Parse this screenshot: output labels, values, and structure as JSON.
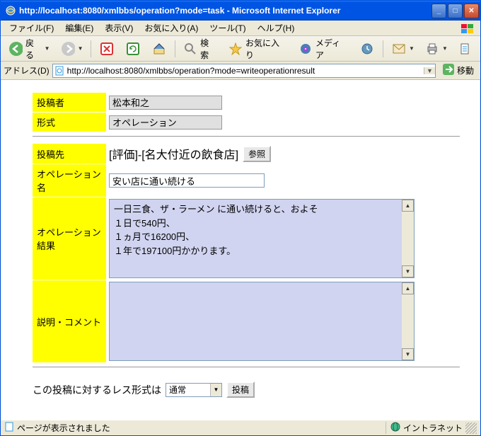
{
  "window_title": "http://localhost:8080/xmlbbs/operation?mode=task - Microsoft Internet Explorer",
  "menu": {
    "file": "ファイル(F)",
    "edit": "編集(E)",
    "view": "表示(V)",
    "favorites": "お気に入り(A)",
    "tools": "ツール(T)",
    "help": "ヘルプ(H)"
  },
  "toolbar": {
    "back": "戻る",
    "search": "検索",
    "favorites": "お気に入り",
    "media": "メディア"
  },
  "address": {
    "label": "アドレス(D)",
    "value": "http://localhost:8080/xmlbbs/operation?mode=writeoperationresult",
    "go": "移動"
  },
  "form": {
    "author_label": "投稿者",
    "author_value": "松本和之",
    "format_label": "形式",
    "format_value": "オペレーション",
    "destination_label": "投稿先",
    "destination_value": "[評価]-[名大付近の飲食店]",
    "browse_btn": "参照",
    "opname_label": "オペレーション名",
    "opname_value": "安い店に通い続ける",
    "opresult_label": "オペレーション結果",
    "opresult_value": "一日三食、ザ・ラーメン に通い続けると、およそ\n１日で540円、\n１ヵ月で16200円、\n１年で197100円かかります。",
    "comment_label": "説明・コメント",
    "comment_value": "",
    "reply_format_label": "この投稿に対するレス形式は",
    "reply_format_select": "通常",
    "submit_btn": "投稿"
  },
  "status": {
    "left_text": "ページが表示されました",
    "zone": "イントラネット"
  }
}
